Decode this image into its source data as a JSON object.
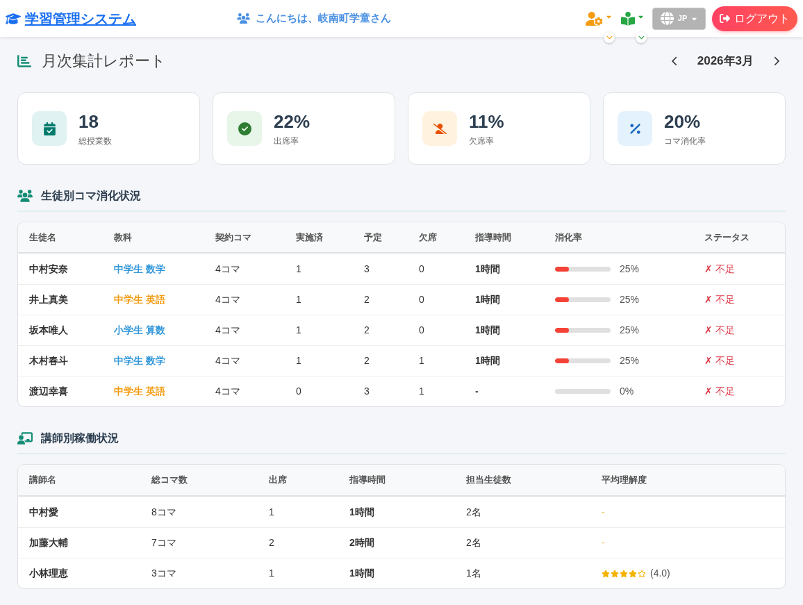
{
  "header": {
    "app_title": "学習管理システム",
    "greeting": "こんにちは、岐南町学童さん",
    "language": "JP",
    "logout": "ログアウト"
  },
  "report": {
    "title": "月次集計レポート",
    "month": "2026年3月"
  },
  "stats": [
    {
      "kind": "lessons",
      "value": "18",
      "label": "総授業数"
    },
    {
      "kind": "attendance",
      "value": "22%",
      "label": "出席率"
    },
    {
      "kind": "absence",
      "value": "11%",
      "label": "欠席率"
    },
    {
      "kind": "consumption",
      "value": "20%",
      "label": "コマ消化率"
    }
  ],
  "students_section": {
    "title": "生徒別コマ消化状況",
    "columns": [
      "生徒名",
      "教科",
      "契約コマ",
      "実施済",
      "予定",
      "欠席",
      "指導時間",
      "消化率",
      "ステータス"
    ],
    "rows": [
      {
        "name": "中村安奈",
        "subject": {
          "text": "中学生 数学",
          "color": "#3498db"
        },
        "contract": "4コマ",
        "done": "1",
        "scheduled": "3",
        "absent": "0",
        "hours": "1時間",
        "progress": {
          "level": 0.25,
          "reading": "25%"
        },
        "status": {
          "kind": "short",
          "text": "✗ 不足"
        }
      },
      {
        "name": "井上真美",
        "subject": {
          "text": "中学生 英語",
          "color": "#f39c12"
        },
        "contract": "4コマ",
        "done": "1",
        "scheduled": "2",
        "absent": "0",
        "hours": "1時間",
        "progress": {
          "level": 0.25,
          "reading": "25%"
        },
        "status": {
          "kind": "short",
          "text": "✗ 不足"
        }
      },
      {
        "name": "坂本唯人",
        "subject": {
          "text": "小学生 算数",
          "color": "#3498db"
        },
        "contract": "4コマ",
        "done": "1",
        "scheduled": "2",
        "absent": "0",
        "hours": "1時間",
        "progress": {
          "level": 0.25,
          "reading": "25%"
        },
        "status": {
          "kind": "short",
          "text": "✗ 不足"
        }
      },
      {
        "name": "木村春斗",
        "subject": {
          "text": "中学生 数学",
          "color": "#3498db"
        },
        "contract": "4コマ",
        "done": "1",
        "scheduled": "2",
        "absent": "1",
        "hours": "1時間",
        "progress": {
          "level": 0.25,
          "reading": "25%"
        },
        "status": {
          "kind": "short",
          "text": "✗ 不足"
        }
      },
      {
        "name": "渡辺幸喜",
        "subject": {
          "text": "中学生 英語",
          "color": "#f39c12"
        },
        "contract": "4コマ",
        "done": "0",
        "scheduled": "3",
        "absent": "1",
        "hours": "-",
        "progress": {
          "level": 0,
          "reading": "0%"
        },
        "status": {
          "kind": "short",
          "text": "✗ 不足"
        }
      }
    ]
  },
  "teachers_section": {
    "title": "講師別稼働状況",
    "columns": [
      "講師名",
      "総コマ数",
      "出席",
      "指導時間",
      "担当生徒数",
      "平均理解度"
    ],
    "rows": [
      {
        "name": "中村愛",
        "total": "8コマ",
        "attended": "1",
        "hours": "1時間",
        "students": "2名",
        "rating": {
          "kind": "none",
          "text": "-"
        }
      },
      {
        "name": "加藤大輔",
        "total": "7コマ",
        "attended": "2",
        "hours": "2時間",
        "students": "2名",
        "rating": {
          "kind": "none",
          "text": "-"
        }
      },
      {
        "name": "小林理恵",
        "total": "3コマ",
        "attended": "1",
        "hours": "1時間",
        "students": "1名",
        "rating": {
          "kind": "stars",
          "stars": 4,
          "text": "(4.0)"
        }
      }
    ]
  }
}
